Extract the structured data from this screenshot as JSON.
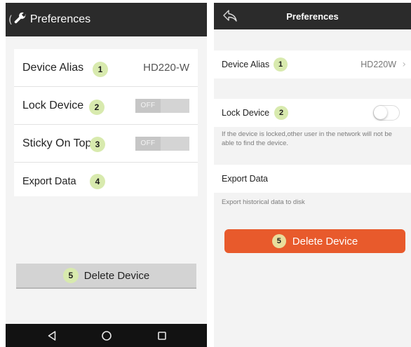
{
  "android": {
    "header": {
      "title": "Preferences",
      "back_glyph": "("
    },
    "rows": [
      {
        "label": "Device Alias",
        "badge": "1",
        "value": "HD220-W"
      },
      {
        "label": "Lock Device",
        "badge": "2",
        "toggle_text": "OFF",
        "toggle_state": "off"
      },
      {
        "label": "Sticky On Top",
        "badge": "3",
        "toggle_text": "OFF",
        "toggle_state": "off"
      },
      {
        "label": "Export Data",
        "badge": "4"
      }
    ],
    "delete": {
      "badge": "5",
      "label": "Delete Device"
    },
    "nav_icons": [
      "back-triangle-icon",
      "home-circle-icon",
      "recents-square-icon"
    ]
  },
  "ios": {
    "header": {
      "title": "Preferences"
    },
    "device_alias": {
      "label": "Device Alias",
      "badge": "1",
      "value": "HD220W",
      "chevron": "›"
    },
    "lock_device": {
      "label": "Lock Device",
      "badge": "2",
      "switch_state": "off"
    },
    "lock_note": "If the device is locked,other user in the network will not be able to find the device.",
    "export": {
      "label": "Export Data",
      "note": "Export historical data to disk"
    },
    "delete": {
      "badge": "5",
      "label": "Delete Device"
    }
  },
  "colors": {
    "header_bg": "#2b2b2b",
    "badge_bg": "#d8eaae",
    "ios_delete_bg": "#e85a2c",
    "android_delete_bg": "#d3d3d3",
    "nav_bar_bg": "#121212"
  }
}
